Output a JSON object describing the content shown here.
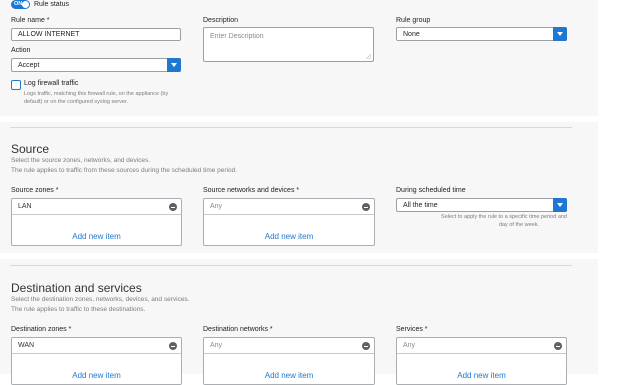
{
  "rule_status": {
    "toggle_text": "ON",
    "label": "Rule status"
  },
  "general": {
    "rule_name_label": "Rule name *",
    "rule_name_value": "ALLOW INTERNET",
    "description_label": "Description",
    "description_placeholder": "Enter Description",
    "rule_group_label": "Rule group",
    "rule_group_value": "None",
    "action_label": "Action",
    "action_value": "Accept",
    "log_label": "Log firewall traffic",
    "log_help_1": "Logs traffic, matching this firewall rule, on the appliance (by",
    "log_help_2": "default) or on the configured syslog server."
  },
  "source": {
    "title": "Source",
    "desc1": "Select the source zones, networks, and devices.",
    "desc2": "The rule applies to traffic from these sources during the scheduled time period.",
    "zones_label": "Source zones *",
    "zones_value": "LAN",
    "networks_label": "Source networks and devices *",
    "networks_value": "Any",
    "schedule_label": "During scheduled time",
    "schedule_value": "All the time",
    "schedule_help_1": "Select to apply the rule to a specific time period and",
    "schedule_help_2": "day of the week.",
    "add_new_item": "Add new item"
  },
  "destination": {
    "title": "Destination and services",
    "desc1": "Select the destination zones, networks, devices, and services.",
    "desc2": "The rule applies to traffic to these destinations.",
    "zones_label": "Destination zones *",
    "zones_value": "WAN",
    "networks_label": "Destination networks *",
    "networks_value": "Any",
    "services_label": "Services *",
    "services_value": "Any",
    "add_new_item": "Add new item"
  },
  "colors": {
    "accent": "#1e78d2",
    "panel": "#f7f7f8"
  },
  "icons": [
    "toggle-switch",
    "chevron-down-icon",
    "remove-circle-icon",
    "checkbox"
  ]
}
